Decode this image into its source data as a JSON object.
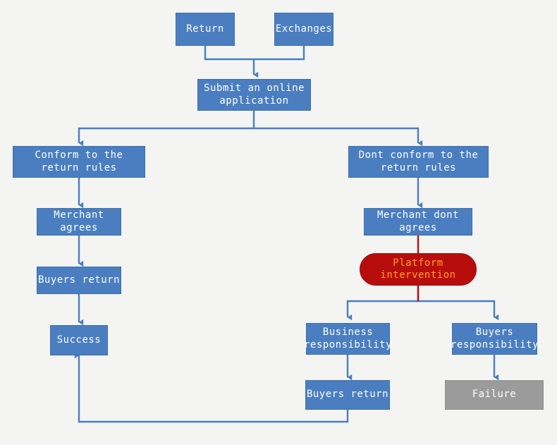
{
  "diagram": {
    "title": "Return and exchange handling flowchart",
    "background_color": "#f4f4f2",
    "palette": {
      "node_blue": "#4a7ec1",
      "node_blue_border": "#3d6fae",
      "node_red": "#b80d0d",
      "node_red_text": "#ffa31a",
      "node_gray": "#9b9b9b",
      "connector_blue": "#4a7ec1",
      "connector_red": "#b80d0d",
      "node_text": "#ffffff"
    },
    "nodes": [
      {
        "id": "return",
        "label": "Return",
        "shape": "rect",
        "style": "blue"
      },
      {
        "id": "exchanges",
        "label": "Exchanges",
        "shape": "rect",
        "style": "blue"
      },
      {
        "id": "submit",
        "label": "Submit an online\napplication",
        "shape": "rect",
        "style": "blue"
      },
      {
        "id": "conform",
        "label": "Conform to the\nreturn rules",
        "shape": "rect",
        "style": "blue"
      },
      {
        "id": "dont-conform",
        "label": "Dont conform to the\nreturn rules",
        "shape": "rect",
        "style": "blue"
      },
      {
        "id": "merchant-agrees",
        "label": "Merchant agrees",
        "shape": "rect",
        "style": "blue"
      },
      {
        "id": "merchant-dont",
        "label": "Merchant dont agrees",
        "shape": "rect",
        "style": "blue"
      },
      {
        "id": "buyers-return-left",
        "label": "Buyers return",
        "shape": "rect",
        "style": "blue"
      },
      {
        "id": "platform",
        "label": "Platform\nintervention",
        "shape": "pill",
        "style": "red"
      },
      {
        "id": "success",
        "label": "Success",
        "shape": "rect",
        "style": "blue"
      },
      {
        "id": "business-resp",
        "label": "Business\nresponsibility",
        "shape": "rect",
        "style": "blue"
      },
      {
        "id": "buyers-resp",
        "label": "Buyers\nresponsibility",
        "shape": "rect",
        "style": "blue"
      },
      {
        "id": "buyers-return-mid",
        "label": "Buyers return",
        "shape": "rect",
        "style": "blue"
      },
      {
        "id": "failure",
        "label": "Failure",
        "shape": "rect",
        "style": "gray"
      }
    ],
    "edges": [
      {
        "from": "return",
        "to": "submit",
        "type": "merge-down"
      },
      {
        "from": "exchanges",
        "to": "submit",
        "type": "merge-down"
      },
      {
        "from": "submit",
        "to": "conform",
        "type": "split-down"
      },
      {
        "from": "submit",
        "to": "dont-conform",
        "type": "split-down"
      },
      {
        "from": "conform",
        "to": "merchant-agrees",
        "type": "straight-down"
      },
      {
        "from": "merchant-agrees",
        "to": "buyers-return-left",
        "type": "straight-down"
      },
      {
        "from": "buyers-return-left",
        "to": "success",
        "type": "straight-down"
      },
      {
        "from": "dont-conform",
        "to": "merchant-dont",
        "type": "straight-down"
      },
      {
        "from": "merchant-dont",
        "to": "platform",
        "type": "straight-down"
      },
      {
        "from": "platform",
        "to": "business-resp",
        "type": "split-down"
      },
      {
        "from": "platform",
        "to": "buyers-resp",
        "type": "split-down"
      },
      {
        "from": "business-resp",
        "to": "buyers-return-mid",
        "type": "straight-down"
      },
      {
        "from": "buyers-resp",
        "to": "failure",
        "type": "straight-down"
      },
      {
        "from": "buyers-return-mid",
        "to": "success",
        "type": "loop-back-up-left"
      }
    ]
  }
}
